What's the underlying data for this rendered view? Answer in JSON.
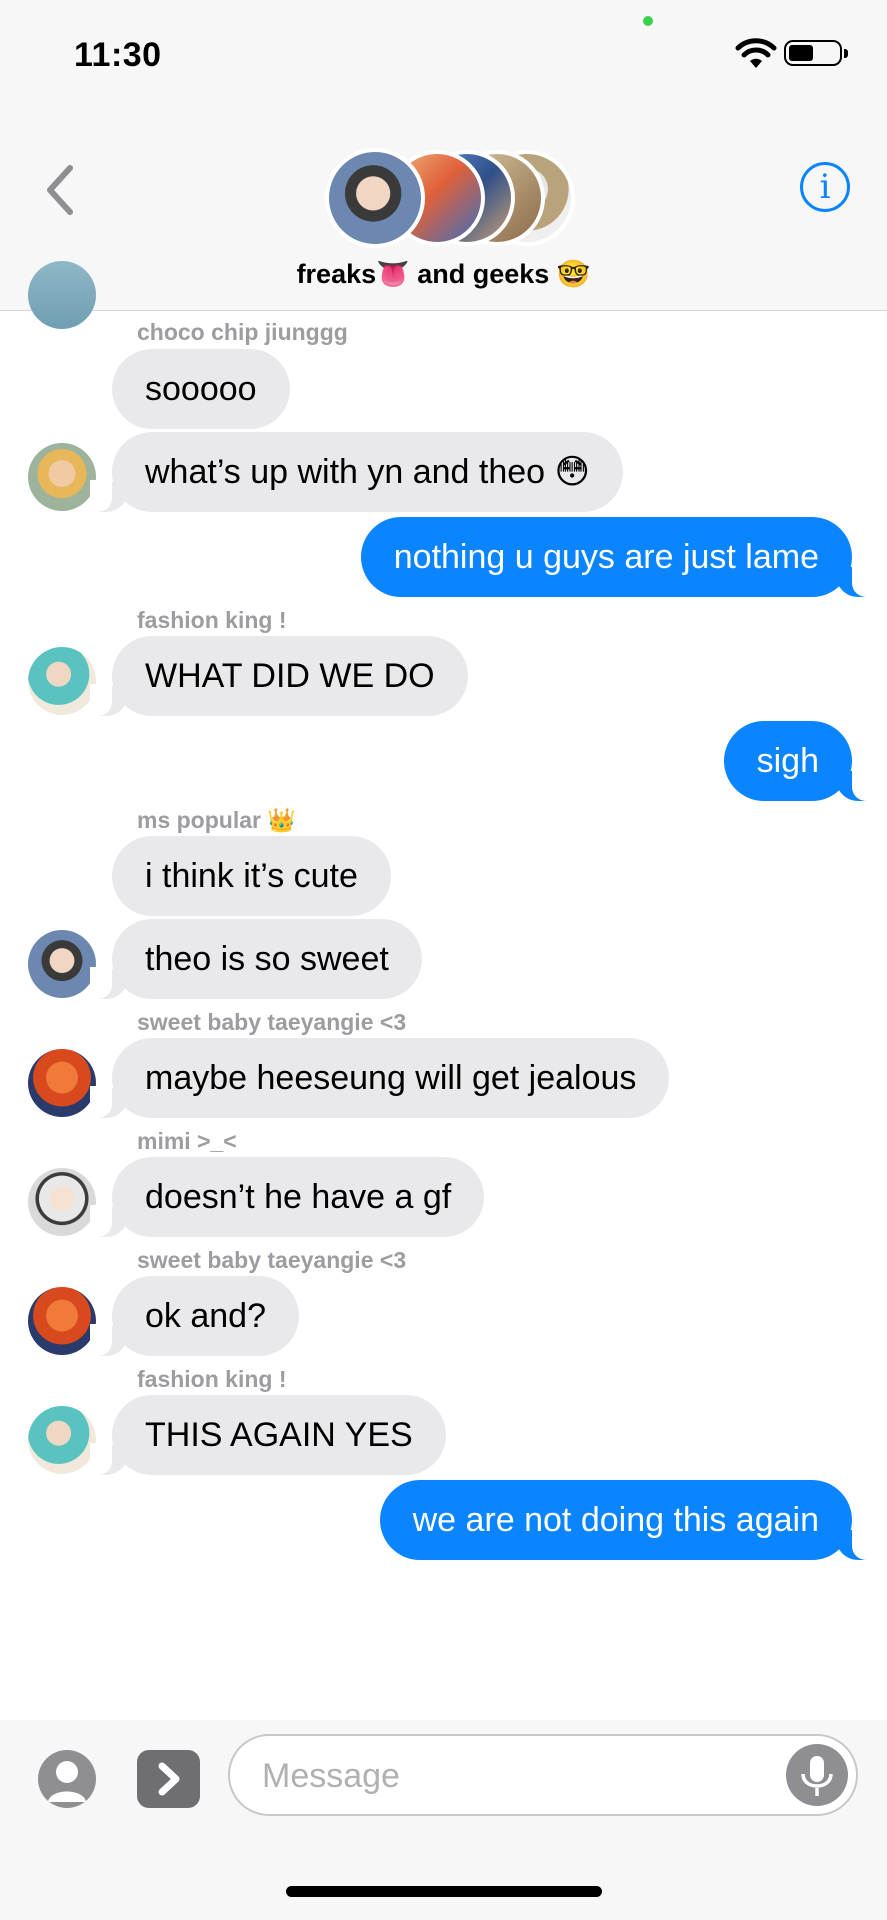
{
  "status_bar": {
    "time": "11:30"
  },
  "header": {
    "group_name": "freaks👅 and geeks 🤓",
    "icons": [
      "back-chevron-icon",
      "info-icon"
    ]
  },
  "messages": [
    {
      "sender": "choco chip jiunggg",
      "text": "sooooo",
      "direction": "in"
    },
    {
      "text": "what’s up with yn and theo 😳",
      "direction": "in"
    },
    {
      "text": "nothing u guys are just lame",
      "direction": "out"
    },
    {
      "sender": "fashion king !",
      "text": "WHAT DID WE DO",
      "direction": "in"
    },
    {
      "text": "sigh",
      "direction": "out"
    },
    {
      "sender": "ms popular 👑",
      "text": "i think it’s cute",
      "direction": "in"
    },
    {
      "text": "theo is so sweet",
      "direction": "in"
    },
    {
      "sender": "sweet baby taeyangie <3",
      "text": "maybe heeseung will get jealous",
      "direction": "in"
    },
    {
      "sender": "mimi >_<",
      "text": "doesn’t he have a gf",
      "direction": "in"
    },
    {
      "sender": "sweet baby taeyangie <3",
      "text": "ok and?",
      "direction": "in"
    },
    {
      "sender": "fashion king !",
      "text": "THIS AGAIN YES",
      "direction": "in"
    },
    {
      "text": "we are not doing this again",
      "direction": "out"
    }
  ],
  "input_bar": {
    "placeholder": "Message"
  },
  "colors": {
    "accent": "#0a84ff",
    "incoming_bubble": "#e9e9eb",
    "sender_label": "#9c9ca1"
  }
}
